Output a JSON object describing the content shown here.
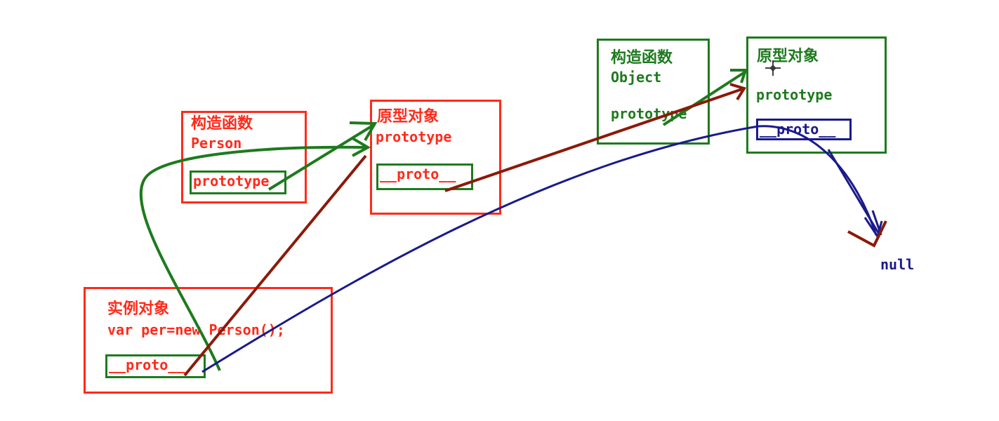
{
  "colors": {
    "red": "#ff2a1a",
    "green": "#1e7a1e",
    "blue": "#1a1a8c",
    "dark_red": "#8b1a0a"
  },
  "person_constructor": {
    "title": "构造函数",
    "name": "Person",
    "slot": "prototype"
  },
  "person_prototype": {
    "title": "原型对象",
    "subtitle": "prototype",
    "slot": "__proto__"
  },
  "instance": {
    "title": "实例对象",
    "code": "var per=new Person();",
    "slot": "__proto__"
  },
  "object_constructor": {
    "title": "构造函数",
    "name": "Object",
    "slot": "prototype"
  },
  "object_prototype": {
    "title": "原型对象",
    "subtitle": "prototype",
    "slot": "__proto__"
  },
  "end_label": "null"
}
